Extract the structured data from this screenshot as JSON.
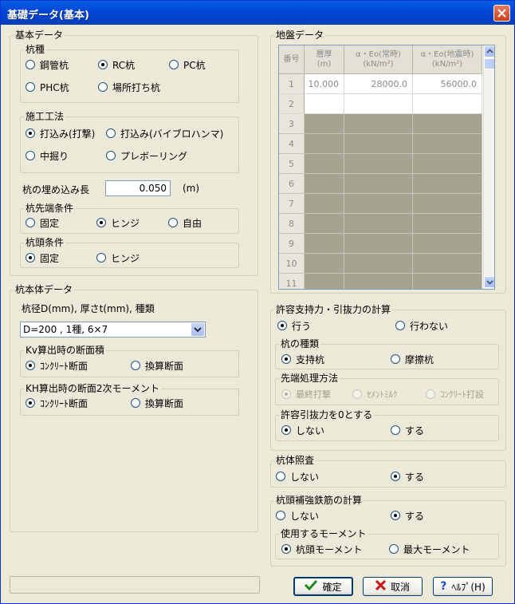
{
  "window": {
    "title": "基礎データ(基本)"
  },
  "basic": {
    "legend": "基本データ",
    "pile_type": {
      "legend": "杭種",
      "options": [
        "鋼管杭",
        "RC杭",
        "PC杭",
        "PHC杭",
        "場所打ち杭"
      ],
      "selected": "RC杭"
    },
    "construction": {
      "legend": "施工工法",
      "options": [
        "打込み(打撃)",
        "打込み(バイブロハンマ)",
        "中掘り",
        "プレボーリング"
      ],
      "selected": "打込み(打撃)"
    },
    "embed": {
      "label": "杭の埋め込み長",
      "value": "0.050",
      "unit": "(m)"
    },
    "tip_condition": {
      "legend": "杭先端条件",
      "options": [
        "固定",
        "ヒンジ",
        "自由"
      ],
      "selected": "ヒンジ"
    },
    "head_condition": {
      "legend": "杭頭条件",
      "options": [
        "固定",
        "ヒンジ"
      ],
      "selected": "固定"
    }
  },
  "pile_body": {
    "legend": "杭本体データ",
    "size_label": "杭径D(mm), 厚さt(mm), 種類",
    "size_value": "D=200 ,  1種, 6×7",
    "kv_area": {
      "legend": "Kv算出時の断面積",
      "options": [
        "ｺﾝｸﾘｰﾄ断面",
        "換算断面"
      ],
      "selected": "ｺﾝｸﾘｰﾄ断面"
    },
    "kh_moment": {
      "legend": "KH算出時の断面2次モーメント",
      "options": [
        "ｺﾝｸﾘｰﾄ断面",
        "換算断面"
      ],
      "selected": "ｺﾝｸﾘｰﾄ断面"
    }
  },
  "ground": {
    "legend": "地盤データ",
    "headers": [
      {
        "line1": "番号",
        "line2": ""
      },
      {
        "line1": "層厚",
        "line2": "(m)"
      },
      {
        "line1": "α・Eo(常時)",
        "line2": "(kN/m²)"
      },
      {
        "line1": "α・Eo(地震時)",
        "line2": "(kN/m²)"
      }
    ],
    "rows": [
      {
        "no": "1",
        "thickness": "10.000",
        "eo_normal": "28000.0",
        "eo_quake": "56000.0"
      },
      {
        "no": "2",
        "thickness": "",
        "eo_normal": "",
        "eo_quake": ""
      },
      {
        "no": "3",
        "thickness": "",
        "eo_normal": "",
        "eo_quake": ""
      },
      {
        "no": "4",
        "thickness": "",
        "eo_normal": "",
        "eo_quake": ""
      },
      {
        "no": "5",
        "thickness": "",
        "eo_normal": "",
        "eo_quake": ""
      },
      {
        "no": "6",
        "thickness": "",
        "eo_normal": "",
        "eo_quake": ""
      },
      {
        "no": "7",
        "thickness": "",
        "eo_normal": "",
        "eo_quake": ""
      },
      {
        "no": "8",
        "thickness": "",
        "eo_normal": "",
        "eo_quake": ""
      },
      {
        "no": "9",
        "thickness": "",
        "eo_normal": "",
        "eo_quake": ""
      },
      {
        "no": "10",
        "thickness": "",
        "eo_normal": "",
        "eo_quake": ""
      },
      {
        "no": "11",
        "thickness": "",
        "eo_normal": "",
        "eo_quake": ""
      }
    ]
  },
  "capacity": {
    "legend": "許容支持力・引抜力の計算",
    "calc": {
      "options": [
        "行う",
        "行わない"
      ],
      "selected": "行う"
    },
    "pile_kind": {
      "legend": "杭の種類",
      "options": [
        "支持杭",
        "摩擦杭"
      ],
      "selected": "支持杭"
    },
    "tip_method": {
      "legend": "先端処理方法",
      "options": [
        "最終打撃",
        "ｾﾒﾝﾄﾐﾙｸ",
        "ｺﾝｸﾘｰﾄ打設"
      ],
      "selected": "最終打撃"
    },
    "pullout_zero": {
      "legend": "許容引抜力を0とする",
      "options": [
        "しない",
        "する"
      ],
      "selected": "しない"
    }
  },
  "body_check": {
    "legend": "杭体照査",
    "options": [
      "しない",
      "する"
    ],
    "selected": "する"
  },
  "rebar": {
    "legend": "杭頭補強鉄筋の計算",
    "options": [
      "しない",
      "する"
    ],
    "selected": "する",
    "moment": {
      "legend": "使用するモーメント",
      "options": [
        "杭頭モーメント",
        "最大モーメント"
      ],
      "selected": "杭頭モーメント"
    }
  },
  "buttons": {
    "ok": "確定",
    "cancel": "取消",
    "help": "ﾍﾙﾌﾟ(H)"
  },
  "icons": {
    "ok": "check-icon",
    "cancel": "x-icon",
    "help": "question-icon",
    "close": "close-icon"
  }
}
